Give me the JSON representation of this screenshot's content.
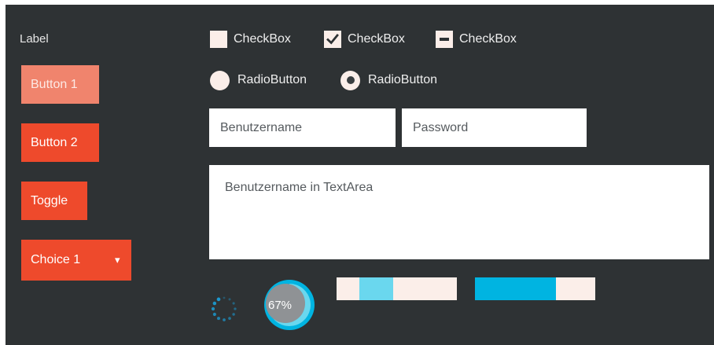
{
  "label": "Label",
  "buttons": {
    "button1": "Button 1",
    "button2": "Button 2",
    "toggle": "Toggle",
    "choice": "Choice 1",
    "choice_arrow": "▾"
  },
  "checkboxes": [
    {
      "label": "CheckBox",
      "state": "unchecked"
    },
    {
      "label": "CheckBox",
      "state": "checked"
    },
    {
      "label": "CheckBox",
      "state": "indeterminate"
    }
  ],
  "radios": [
    {
      "label": "RadioButton",
      "selected": false
    },
    {
      "label": "RadioButton",
      "selected": true
    }
  ],
  "fields": {
    "username_placeholder": "Benutzername",
    "password_placeholder": "Password",
    "textarea_text": "Benutzername in TextArea"
  },
  "progress_indicator": {
    "value": 0.67,
    "label": "67%"
  },
  "progress_bars": [
    {
      "secondary_fraction": 0.47,
      "primary_fraction": 0.19
    },
    {
      "primary_fraction": 0.67
    }
  ],
  "colors": {
    "background": "#2e3234",
    "accent": "#ee4a2c",
    "accent_light": "#f0846d",
    "control_fill": "#fbeee9",
    "progress_primary": "#00b4e1",
    "progress_secondary": "#6ad7ee",
    "spinner": "#1a9fd8"
  },
  "icons": {
    "checkmark": "checkmark-icon",
    "indeterminate": "minus-icon",
    "dropdown": "chevron-down-icon",
    "spinner": "spinner-icon"
  }
}
